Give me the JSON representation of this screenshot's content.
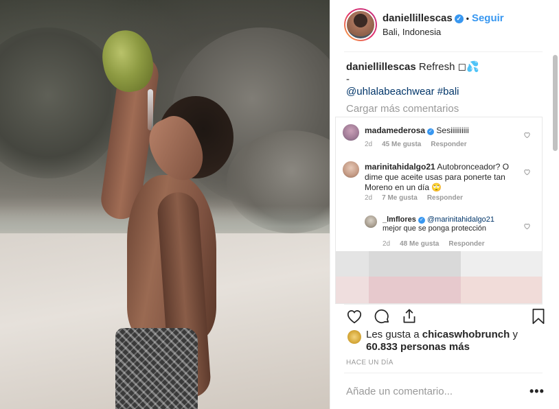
{
  "post": {
    "username": "daniellillescas",
    "verified_mark": "✓",
    "separator": "•",
    "follow_label": "Seguir",
    "location": "Bali, Indonesia"
  },
  "caption": {
    "username": "daniellillescas",
    "text": "Refresh ◻💦",
    "dash": "-",
    "tags": "@uhlalabeachwear #bali"
  },
  "load_more_label": "Cargar más comentarios",
  "comments": [
    {
      "username": "madamederosa",
      "verified": true,
      "text": "Sesiiiiiiiiii",
      "age": "2d",
      "likes": "45 Me gusta",
      "reply": "Responder"
    },
    {
      "username": "marinitahidalgo21",
      "verified": false,
      "text": "Autobronceador? O dime que aceite usas para ponerte tan Moreno en un día 🙄",
      "age": "2d",
      "likes": "7 Me gusta",
      "reply": "Responder"
    },
    {
      "username": "_lmflores",
      "verified": true,
      "mention": "@marinitahidalgo21",
      "text": "mejor que se ponga protección",
      "age": "2d",
      "likes": "48 Me gusta",
      "reply": "Responder"
    }
  ],
  "icons": {
    "like": "heart-icon",
    "comment": "comment-icon",
    "share": "share-icon",
    "save": "bookmark-icon",
    "more": "more-options-icon"
  },
  "likes": {
    "prefix": "Les gusta a",
    "liker": "chicaswhobrunch",
    "connector": "y",
    "count": "60.833 personas más"
  },
  "time_ago": "HACE UN DÍA",
  "comment_placeholder": "Añade un comentario...",
  "more_label": "•••",
  "colors": {
    "accent": "#3897f0",
    "tag": "#003569",
    "muted": "#999999"
  }
}
